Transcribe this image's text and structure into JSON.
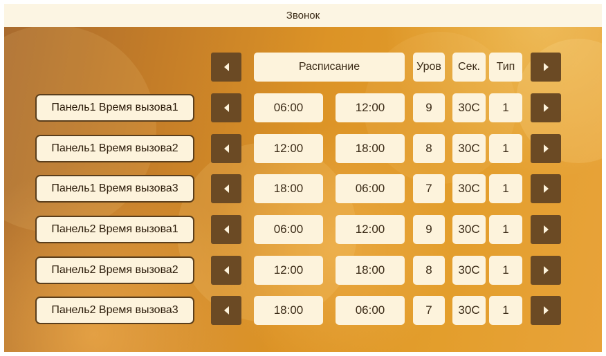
{
  "title": "Звонок",
  "header": {
    "schedule": "Расписание",
    "level": "Уров",
    "sec": "Сек.",
    "type": "Тип"
  },
  "rows": [
    {
      "label": "Панель1 Время вызова1",
      "start": "06:00",
      "end": "12:00",
      "level": "9",
      "sec": "30С",
      "type": "1"
    },
    {
      "label": "Панель1 Время вызова2",
      "start": "12:00",
      "end": "18:00",
      "level": "8",
      "sec": "30С",
      "type": "1"
    },
    {
      "label": "Панель1 Время вызова3",
      "start": "18:00",
      "end": "06:00",
      "level": "7",
      "sec": "30С",
      "type": "1"
    },
    {
      "label": "Панель2 Время вызова1",
      "start": "06:00",
      "end": "12:00",
      "level": "9",
      "sec": "30С",
      "type": "1"
    },
    {
      "label": "Панель2 Время вызова2",
      "start": "12:00",
      "end": "18:00",
      "level": "8",
      "sec": "30С",
      "type": "1"
    },
    {
      "label": "Панель2 Время вызова3",
      "start": "18:00",
      "end": "06:00",
      "level": "7",
      "sec": "30С",
      "type": "1"
    }
  ],
  "icons": {
    "left": "arrow-left-icon",
    "right": "arrow-right-icon"
  },
  "colors": {
    "panel_bg": "#fdf3dc",
    "arrow_bg": "#6b4a24",
    "background_accent": "#dc9326"
  }
}
